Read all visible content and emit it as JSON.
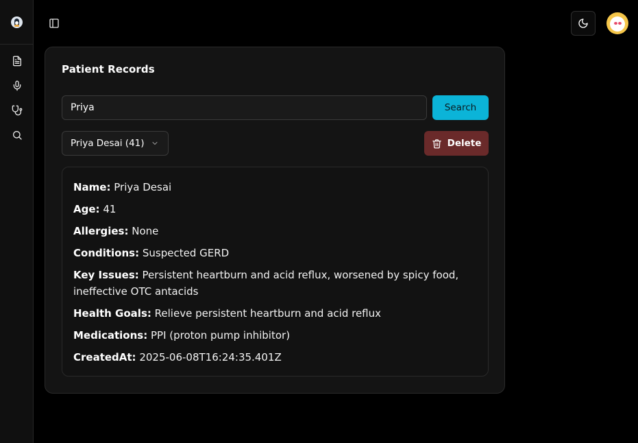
{
  "sidebar": {
    "logo": "penguin-logo",
    "items": [
      {
        "name": "document-icon"
      },
      {
        "name": "microphone-icon"
      },
      {
        "name": "stethoscope-icon"
      },
      {
        "name": "search-icon"
      }
    ]
  },
  "header": {
    "toggle_icon": "sidebar-toggle-icon",
    "theme_icon": "moon-icon",
    "avatar": "user-avatar"
  },
  "card": {
    "title": "Patient Records",
    "search_value": "Priya",
    "search_button": "Search",
    "select_value": "Priya Desai (41)",
    "delete_button": "Delete"
  },
  "record": {
    "name_label": "Name:",
    "name": "Priya Desai",
    "age_label": "Age:",
    "age": "41",
    "allergies_label": "Allergies:",
    "allergies": "None",
    "conditions_label": "Conditions:",
    "conditions": "Suspected GERD",
    "key_issues_label": "Key Issues:",
    "key_issues": "Persistent heartburn and acid reflux, worsened by spicy food, ineffective OTC antacids",
    "health_goals_label": "Health Goals:",
    "health_goals": "Relieve persistent heartburn and acid reflux",
    "medications_label": "Medications:",
    "medications": "PPI (proton pump inhibitor)",
    "created_label": "CreatedAt:",
    "created": "2025-06-08T16:24:35.401Z"
  },
  "colors": {
    "accent": "#0bb4d8",
    "danger": "#6a2a2a",
    "background": "#000000",
    "card": "#141414"
  }
}
